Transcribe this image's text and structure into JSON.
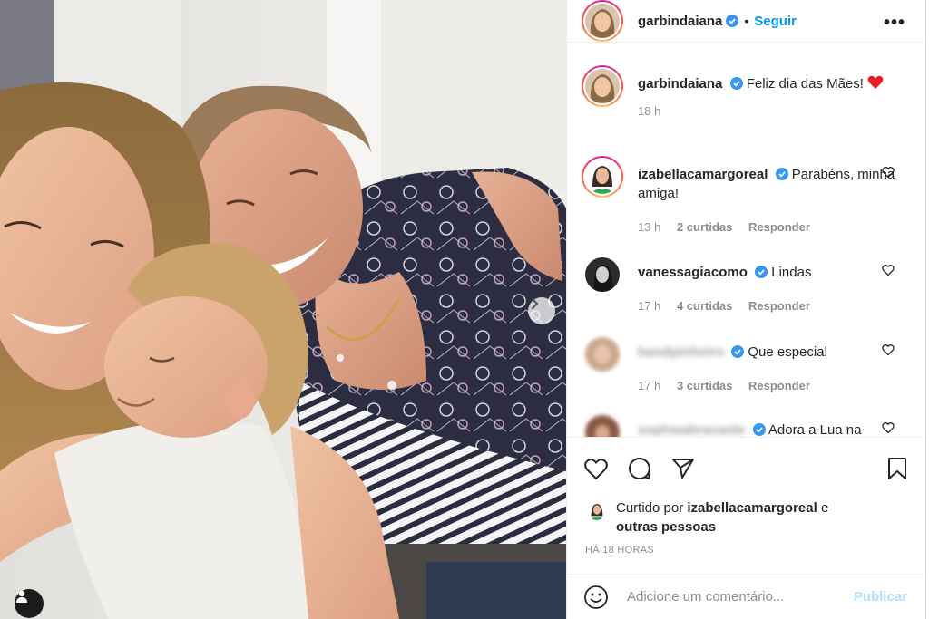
{
  "post": {
    "author": "garbindaiana",
    "follow_label": "Seguir",
    "separator": "•",
    "more_label": "•••"
  },
  "caption": {
    "user": "garbindaiana",
    "text": "Feliz dia das Mães!",
    "emoji": "❤️",
    "time": "18 h"
  },
  "comments": [
    {
      "user": "izabellacamargoreal",
      "text": "Parabéns, minha amiga!",
      "time": "13 h",
      "likes": "2 curtidas",
      "reply": "Responder",
      "verified": true
    },
    {
      "user": "vanessagiacomo",
      "text": "Lindas",
      "time": "17 h",
      "likes": "4 curtidas",
      "reply": "Responder",
      "verified": true
    },
    {
      "user": "bandpinheiro",
      "text": "Que especial",
      "time": "17 h",
      "likes": "3 curtidas",
      "reply": "Responder",
      "verified": true
    },
    {
      "user": "sophiaabravanle",
      "text": "Adora a Lua na",
      "verified": true
    }
  ],
  "likes": {
    "prefix": "Curtido por",
    "user": "izabellacamargoreal",
    "conj": "e",
    "others": "outras pessoas"
  },
  "timestamp": "HÁ 18 HORAS",
  "comment_input": {
    "placeholder": "Adicione um comentário...",
    "publish": "Publicar"
  },
  "icons": {
    "verified": "verified-badge-icon",
    "like": "heart-icon",
    "comment": "comment-bubble-icon",
    "share": "paper-plane-icon",
    "save": "bookmark-icon",
    "emoji": "smiley-icon",
    "next": "chevron-right-icon",
    "tag": "user-tag-icon"
  },
  "colors": {
    "accent": "#0095f6",
    "verified": "#3897f0",
    "publish_disabled": "#b2dffc",
    "secondary_text": "#8e8e8e",
    "heart_red": "#ed1c24"
  }
}
